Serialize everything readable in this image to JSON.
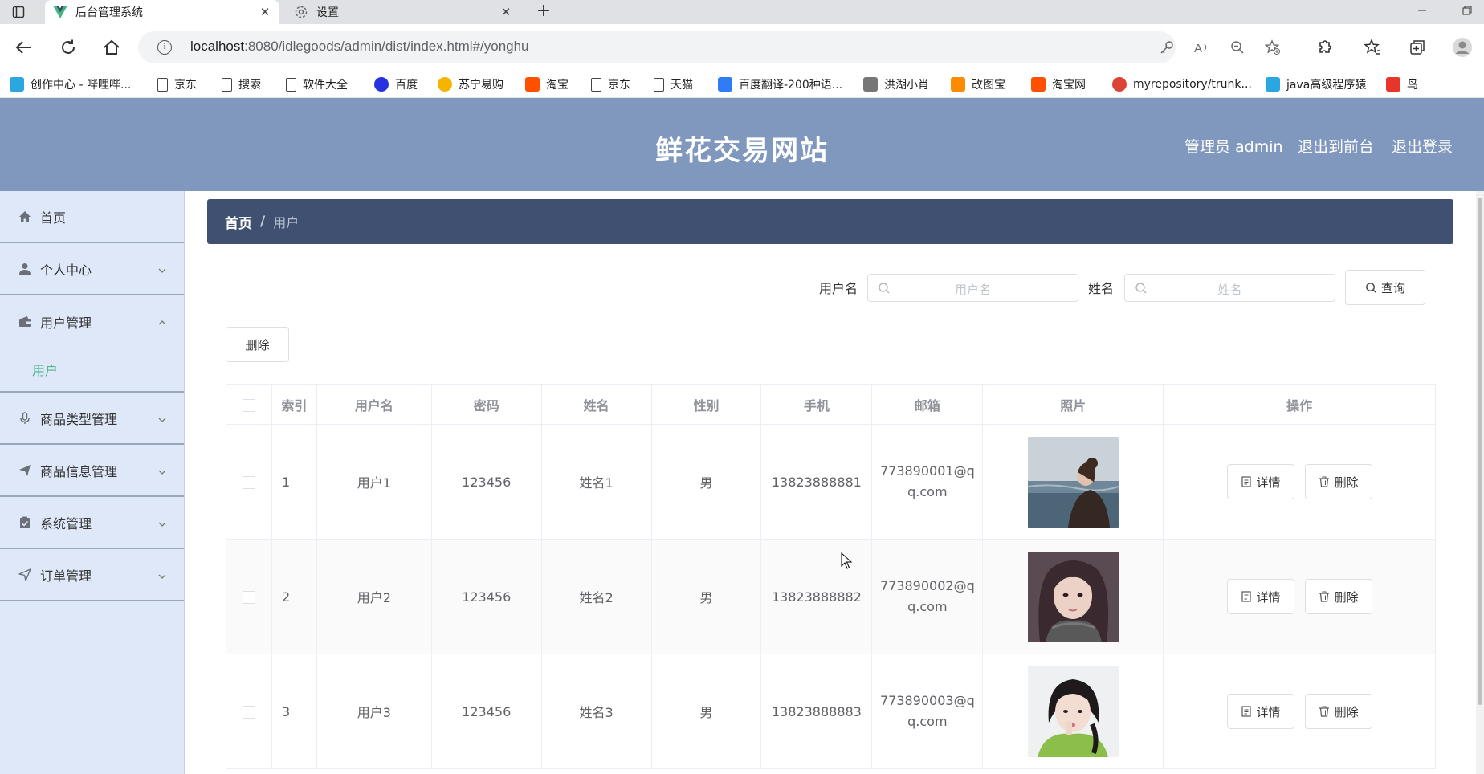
{
  "browser": {
    "tabs": [
      {
        "title": "后台管理系统",
        "active": true
      },
      {
        "title": "设置",
        "active": false
      }
    ],
    "url_host": "localhost",
    "url_path": ":8080/idlegoods/admin/dist/index.html#/yonghu",
    "bookmarks": [
      {
        "label": "创作中心 - 哔哩哔...",
        "icon": "bilibili-icon",
        "color": "#2aa7e0"
      },
      {
        "label": "京东",
        "icon": "page-icon"
      },
      {
        "label": "搜索",
        "icon": "page-icon"
      },
      {
        "label": "软件大全",
        "icon": "page-icon"
      },
      {
        "label": "百度",
        "icon": "baidu-paw-icon",
        "color": "#2932e1"
      },
      {
        "label": "苏宁易购",
        "icon": "suning-icon",
        "color": "#f5b400"
      },
      {
        "label": "淘宝",
        "icon": "taobao-icon",
        "color": "#ff5000"
      },
      {
        "label": "京东",
        "icon": "page-icon"
      },
      {
        "label": "天猫",
        "icon": "page-icon"
      },
      {
        "label": "百度翻译-200种语...",
        "icon": "translate-icon",
        "color": "#2f7cf6"
      },
      {
        "label": "洪湖小肖",
        "icon": "bird-icon",
        "color": "#777777"
      },
      {
        "label": "改图宝",
        "icon": "gaitubao-icon",
        "color": "#ff8c00"
      },
      {
        "label": "淘宝网",
        "icon": "taobao-icon",
        "color": "#ff5000"
      },
      {
        "label": "myrepository/trunk...",
        "icon": "chrome-icon",
        "color": "#db4437"
      },
      {
        "label": "java高级程序猿",
        "icon": "bilibili-icon",
        "color": "#2aa7e0"
      },
      {
        "label": "鸟",
        "icon": "bird-red-icon",
        "color": "#e8352b"
      }
    ]
  },
  "header": {
    "site_title": "鲜花交易网站",
    "admin_label": "管理员 admin",
    "back_to_front": "退出到前台",
    "logout": "退出登录"
  },
  "sidebar": {
    "items": [
      {
        "label": "首页",
        "icon": "home-icon",
        "arrow": ""
      },
      {
        "label": "个人中心",
        "icon": "user-icon",
        "arrow": "down"
      },
      {
        "label": "用户管理",
        "icon": "wallet-icon",
        "arrow": "up",
        "children": [
          {
            "label": "用户"
          }
        ]
      },
      {
        "label": "商品类型管理",
        "icon": "microphone-icon",
        "arrow": "down"
      },
      {
        "label": "商品信息管理",
        "icon": "send-icon",
        "arrow": "down"
      },
      {
        "label": "系统管理",
        "icon": "clipboard-check-icon",
        "arrow": "down"
      },
      {
        "label": "订单管理",
        "icon": "location-arrow-icon",
        "arrow": "down"
      }
    ]
  },
  "breadcrumb": {
    "home": "首页",
    "separator": "/",
    "current": "用户"
  },
  "search": {
    "username_label": "用户名",
    "username_placeholder": "用户名",
    "name_label": "姓名",
    "name_placeholder": "姓名",
    "query_button": "查询"
  },
  "toolbar": {
    "delete_button": "删除"
  },
  "table": {
    "columns": [
      "索引",
      "用户名",
      "密码",
      "姓名",
      "性别",
      "手机",
      "邮箱",
      "照片",
      "操作"
    ],
    "rows": [
      {
        "index": "1",
        "username": "用户1",
        "password": "123456",
        "name": "姓名1",
        "gender": "男",
        "phone": "13823888881",
        "email": "773890001@qq.com"
      },
      {
        "index": "2",
        "username": "用户2",
        "password": "123456",
        "name": "姓名2",
        "gender": "男",
        "phone": "13823888882",
        "email": "773890002@qq.com"
      },
      {
        "index": "3",
        "username": "用户3",
        "password": "123456",
        "name": "姓名3",
        "gender": "男",
        "phone": "13823888883",
        "email": "773890003@qq.com"
      }
    ],
    "detail_button": "详情",
    "delete_button": "删除"
  },
  "colors": {
    "header_bg": "#8098bd",
    "sidebar_bg": "#dfe8f8",
    "breadcrumb_bg": "#3f5071",
    "active_submenu": "#4fb48d"
  }
}
